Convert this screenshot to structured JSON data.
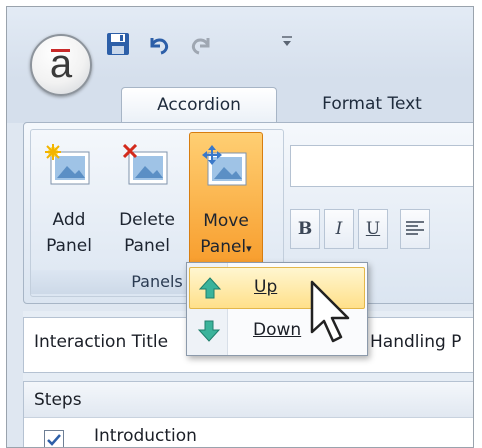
{
  "app_logo": "a",
  "tabs": [
    {
      "label": "Accordion",
      "active": true
    },
    {
      "label": "Format Text",
      "active": false
    }
  ],
  "ribbon": {
    "buttons": [
      {
        "line1": "Add",
        "line2": "Panel",
        "icon": "add-panel-icon"
      },
      {
        "line1": "Delete",
        "line2": "Panel",
        "icon": "delete-panel-icon"
      },
      {
        "line1": "Move",
        "line2": "Panel",
        "icon": "move-panel-icon",
        "active": true
      }
    ],
    "group_label": "Panels",
    "format_buttons": [
      "B",
      "I",
      "U"
    ]
  },
  "move_menu": {
    "items": [
      {
        "label": "Up",
        "icon": "arrow-up-icon",
        "hovered": true
      },
      {
        "label": "Down",
        "icon": "arrow-down-icon",
        "hovered": false
      }
    ]
  },
  "interaction": {
    "title_label": "Interaction Title",
    "title_value": "Handling P"
  },
  "steps": {
    "header": "Steps",
    "items": [
      {
        "label": "Introduction",
        "checked": true
      }
    ]
  },
  "colors": {
    "accent_orange": "#f79b2a",
    "menu_highlight": "#ffe08a",
    "ribbon_blue": "#dbe5f1",
    "arrow_green": "#3bb39b"
  }
}
